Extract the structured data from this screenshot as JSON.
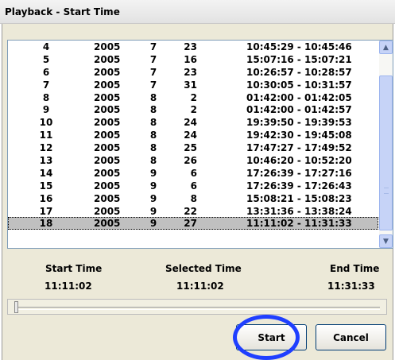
{
  "window": {
    "title": "Playback - Start Time"
  },
  "records": [
    {
      "idx": "4",
      "year": "2005",
      "month": "7",
      "day": "23",
      "range": "10:45:29 - 10:45:46"
    },
    {
      "idx": "5",
      "year": "2005",
      "month": "7",
      "day": "16",
      "range": "15:07:16 - 15:07:21"
    },
    {
      "idx": "6",
      "year": "2005",
      "month": "7",
      "day": "23",
      "range": "10:26:57 - 10:28:57"
    },
    {
      "idx": "7",
      "year": "2005",
      "month": "7",
      "day": "31",
      "range": "10:30:05 - 10:31:57"
    },
    {
      "idx": "8",
      "year": "2005",
      "month": "8",
      "day": "2",
      "range": "01:42:00 - 01:42:05"
    },
    {
      "idx": "9",
      "year": "2005",
      "month": "8",
      "day": "2",
      "range": "01:42:00 - 01:42:57"
    },
    {
      "idx": "10",
      "year": "2005",
      "month": "8",
      "day": "24",
      "range": "19:39:50 - 19:39:53"
    },
    {
      "idx": "11",
      "year": "2005",
      "month": "8",
      "day": "24",
      "range": "19:42:30 - 19:45:08"
    },
    {
      "idx": "12",
      "year": "2005",
      "month": "8",
      "day": "25",
      "range": "17:47:27 - 17:49:52"
    },
    {
      "idx": "13",
      "year": "2005",
      "month": "8",
      "day": "26",
      "range": "10:46:20 - 10:52:20"
    },
    {
      "idx": "14",
      "year": "2005",
      "month": "9",
      "day": "6",
      "range": "17:26:39 - 17:27:16"
    },
    {
      "idx": "15",
      "year": "2005",
      "month": "9",
      "day": "6",
      "range": "17:26:39 - 17:26:43"
    },
    {
      "idx": "16",
      "year": "2005",
      "month": "9",
      "day": "8",
      "range": "15:08:21 - 15:08:23"
    },
    {
      "idx": "17",
      "year": "2005",
      "month": "9",
      "day": "22",
      "range": "13:31:36 - 13:38:24"
    },
    {
      "idx": "18",
      "year": "2005",
      "month": "9",
      "day": "27",
      "range": "11:11:02 - 11:31:33",
      "selected": true
    }
  ],
  "info": {
    "start_label": "Start Time",
    "start_value": "11:11:02",
    "selected_label": "Selected Time",
    "selected_value": "11:11:02",
    "end_label": "End Time",
    "end_value": "11:31:33"
  },
  "slider": {
    "position": 0
  },
  "buttons": {
    "start": "Start",
    "cancel": "Cancel"
  },
  "scrollbar": {
    "up_icon": "▲",
    "down_icon": "▼"
  },
  "colors": {
    "highlight_ring": "#1f3fff",
    "selected_row": "#c0c0c0"
  }
}
